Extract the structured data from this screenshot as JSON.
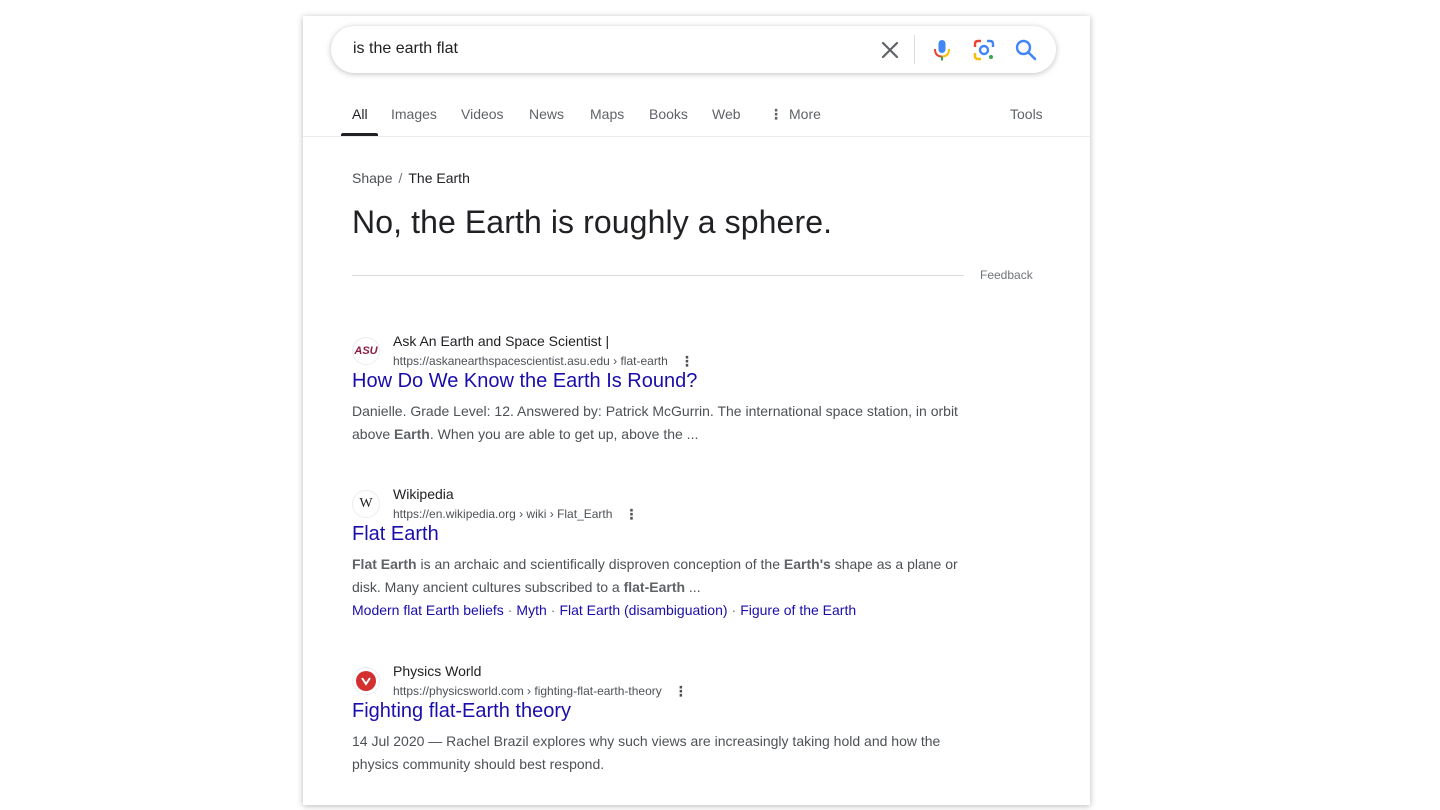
{
  "search": {
    "query": "is the earth flat"
  },
  "icons": {
    "clear": "close-icon",
    "mic": "microphone-icon",
    "lens": "camera-lens-icon",
    "search": "search-icon"
  },
  "tabs": [
    {
      "label": "All",
      "active": true
    },
    {
      "label": "Images"
    },
    {
      "label": "Videos"
    },
    {
      "label": "News"
    },
    {
      "label": "Maps"
    },
    {
      "label": "Books"
    },
    {
      "label": "Web"
    },
    {
      "label": "More"
    }
  ],
  "tools_label": "Tools",
  "answer": {
    "breadcrumb": [
      "Shape",
      "The Earth"
    ],
    "text": "No, the Earth is roughly a sphere.",
    "feedback_label": "Feedback"
  },
  "results": [
    {
      "site_name": "Ask An Earth and Space Scientist |",
      "url": "https://askanearthspacescientist.asu.edu › flat-earth",
      "favicon_text": "ASU",
      "title": "How Do We Know the Earth Is Round?",
      "snippet": [
        "Danielle. Grade Level: 12. Answered by: Patrick McGurrin. The international space station, in orbit above ",
        "Earth",
        ". When you are able to get up, above the ..."
      ]
    },
    {
      "site_name": "Wikipedia",
      "url": "https://en.wikipedia.org › wiki › Flat_Earth",
      "favicon_text": "W",
      "title": "Flat Earth",
      "snippet": [
        "Flat Earth",
        " is an archaic and scientifically disproven conception of the ",
        "Earth's",
        " shape as a plane or disk. Many ancient cultures subscribed to a ",
        "flat-Earth",
        " ..."
      ],
      "sitelinks": [
        "Modern flat Earth beliefs",
        "Myth",
        "Flat Earth (disambiguation)",
        "Figure of the Earth"
      ]
    },
    {
      "site_name": "Physics World",
      "url": "https://physicsworld.com › fighting-flat-earth-theory",
      "title": "Fighting flat-Earth theory",
      "snippet": [
        "14 Jul 2020 — Rachel Brazil explores why such views are increasingly taking hold and how the physics community should best respond."
      ]
    }
  ],
  "colors": {
    "link": "#1a0dab",
    "text": "#202124",
    "muted": "#4d5156"
  }
}
